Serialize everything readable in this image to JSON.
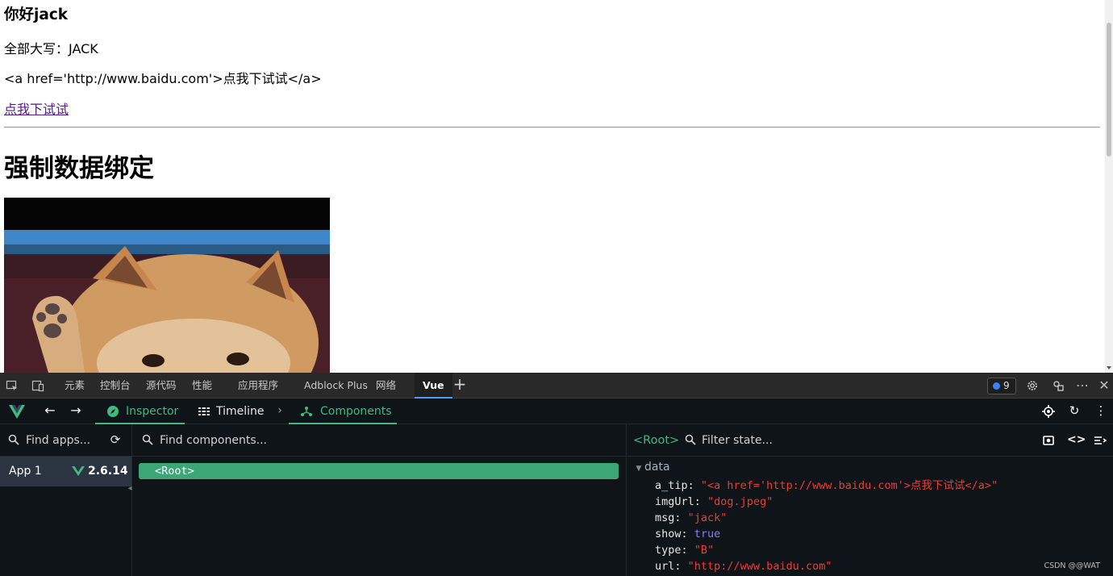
{
  "page": {
    "greeting": "你好jack",
    "upper_line": "全部大写：JACK",
    "raw_html_line": "<a href='http://www.baidu.com'>点我下试试</a>",
    "link_text": "点我下试试",
    "section_title": "强制数据绑定"
  },
  "devtools_tabs": [
    "元素",
    "控制台",
    "源代码",
    "性能",
    "应用程序",
    "Adblock Plus",
    "网络",
    "Vue"
  ],
  "issues_count": "9",
  "vue_header": {
    "inspector": "Inspector",
    "timeline": "Timeline",
    "components": "Components"
  },
  "apps_panel": {
    "search_placeholder": "Find apps...",
    "app_name": "App 1",
    "vue_version": "2.6.14"
  },
  "components_panel": {
    "search_placeholder": "Find components...",
    "root_label": "<Root>"
  },
  "state_panel": {
    "selected": "<Root>",
    "filter_placeholder": "Filter state...",
    "section": "data",
    "fields": [
      {
        "key": "a_tip",
        "value": "\"<a href='http://www.baidu.com'>点我下试试</a>\"",
        "kind": "string"
      },
      {
        "key": "imgUrl",
        "value": "\"dog.jpeg\"",
        "kind": "string"
      },
      {
        "key": "msg",
        "value": "\"jack\"",
        "kind": "string"
      },
      {
        "key": "show",
        "value": "true",
        "kind": "boolean"
      },
      {
        "key": "type",
        "value": "\"B\"",
        "kind": "string"
      },
      {
        "key": "url",
        "value": "\"http://www.baidu.com\"",
        "kind": "string"
      }
    ]
  },
  "watermark": "CSDN @@WAT",
  "colors": {
    "vue_green": "#42b883",
    "root_highlight": "#3ba776",
    "string_value": "#ef3a3a",
    "boolean_value": "#8a7cf5",
    "panel_bg": "#0f1419",
    "toolbar_bg": "#292929"
  },
  "icons": [
    "inspect-element-icon",
    "device-toggle-icon",
    "plus-icon",
    "settings-gear-icon",
    "customize-icon",
    "more-icon",
    "close-icon",
    "vue-logo-icon",
    "back-arrow-icon",
    "forward-arrow-icon",
    "inspector-icon",
    "timeline-icon",
    "components-icon",
    "target-icon",
    "refresh-icon",
    "kebab-icon",
    "search-icon",
    "sync-icon",
    "screenshot-icon",
    "code-icon",
    "state-filter-icon"
  ]
}
